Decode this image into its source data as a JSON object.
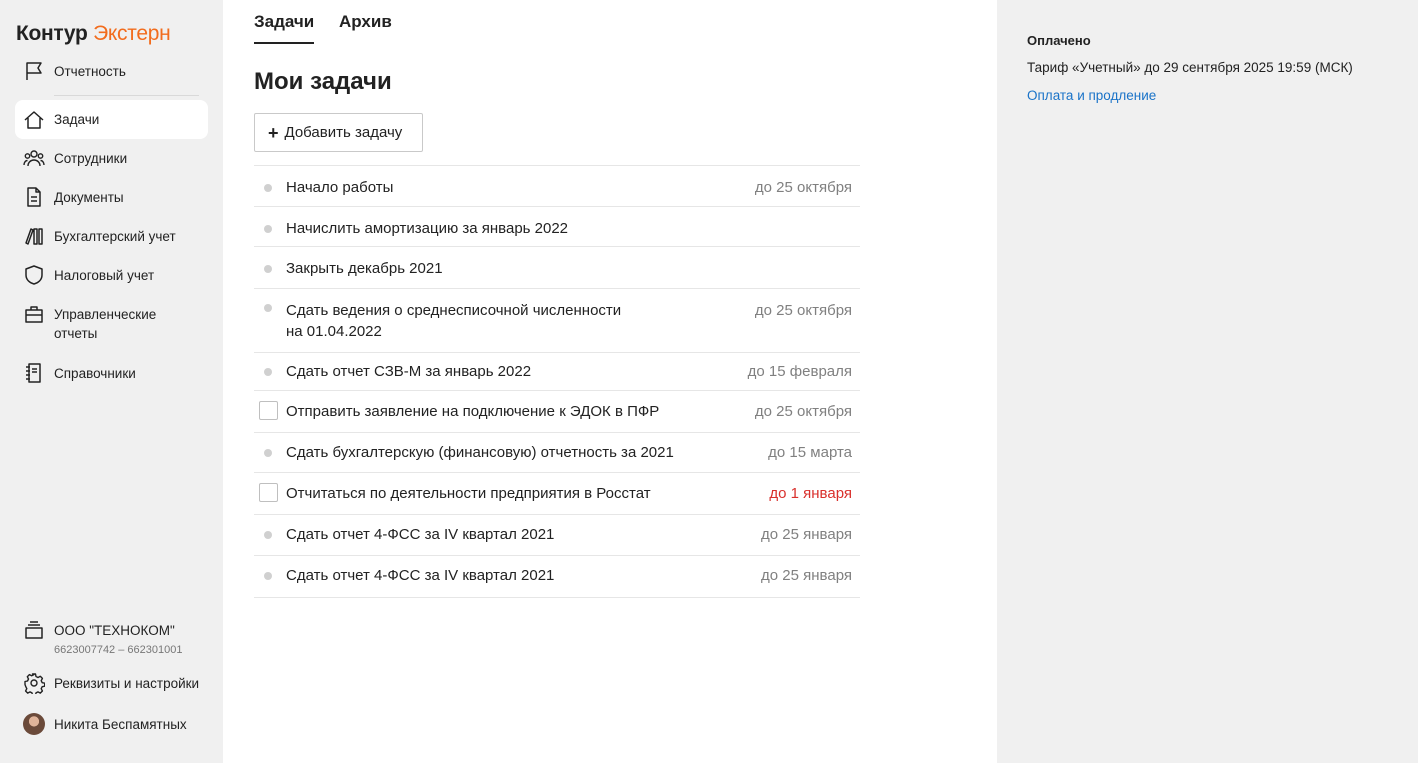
{
  "brand": {
    "part1": "Контур",
    "part2": "Экстерн",
    "accent": "#f26c1d"
  },
  "sidebar": {
    "items": [
      {
        "label": "Отчетность",
        "icon": "flag-icon"
      },
      {
        "label": "Задачи",
        "icon": "home-icon",
        "active": true
      },
      {
        "label": "Сотрудники",
        "icon": "people-icon"
      },
      {
        "label": "Документы",
        "icon": "document-icon"
      },
      {
        "label": "Бухгалтерский учет",
        "icon": "books-icon"
      },
      {
        "label": "Налоговый учет",
        "icon": "shield-icon"
      },
      {
        "label": "Управленческие отчеты",
        "icon": "briefcase-icon"
      },
      {
        "label": "Справочники",
        "icon": "notebook-icon"
      }
    ],
    "org": {
      "name": "ООО \"ТЕХНОКОМ\"",
      "inn": "6623007742 – 662301001",
      "icon": "org-stack-icon"
    },
    "settings": {
      "label": "Реквизиты и настройки",
      "icon": "gear-icon"
    },
    "user": {
      "name": "Никита Беспамятных"
    }
  },
  "tabs": [
    {
      "label": "Задачи",
      "active": true
    },
    {
      "label": "Архив",
      "active": false
    }
  ],
  "main": {
    "title": "Мои задачи",
    "add_button": "Добавить задачу",
    "tasks": [
      {
        "title": "Начало работы",
        "due": "до 25 октября",
        "marker": "dot"
      },
      {
        "title": "Начислить амортизацию за январь 2022",
        "due": "",
        "marker": "dot"
      },
      {
        "title": "Закрыть декабрь 2021",
        "due": "",
        "marker": "dot"
      },
      {
        "title": "Сдать ведения о среднесписочной численности на 01.04.2022",
        "due": "до 25 октября",
        "marker": "dot"
      },
      {
        "title": "Сдать отчет СЗВ-М за январь 2022",
        "due": "до 15 февраля",
        "marker": "dot"
      },
      {
        "title": "Отправить заявление на подключение к ЭДОК в ПФР",
        "due": "до 25 октября",
        "marker": "checkbox"
      },
      {
        "title": "Сдать бухгалтерскую (финансовую) отчетность за 2021",
        "due": "до 15 марта",
        "marker": "dot"
      },
      {
        "title": "Отчитаться по деятельности предприятия в Росстат",
        "due": "до 1 января",
        "marker": "checkbox",
        "overdue": true
      },
      {
        "title": "Сдать отчет 4-ФСС за IV квартал 2021",
        "due": "до 25 января",
        "marker": "dot"
      },
      {
        "title": "Сдать отчет 4-ФСС за IV квартал 2021",
        "due": "до 25 января",
        "marker": "dot"
      }
    ]
  },
  "right_panel": {
    "status": "Оплачено",
    "tariff": "Тариф «Учетный» до 29 сентября 2025 19:59 (МСК)",
    "link": "Оплата и продление"
  },
  "colors": {
    "link": "#1a73c8",
    "overdue": "#d9302c",
    "sidebar_bg": "#f0f0f0"
  }
}
